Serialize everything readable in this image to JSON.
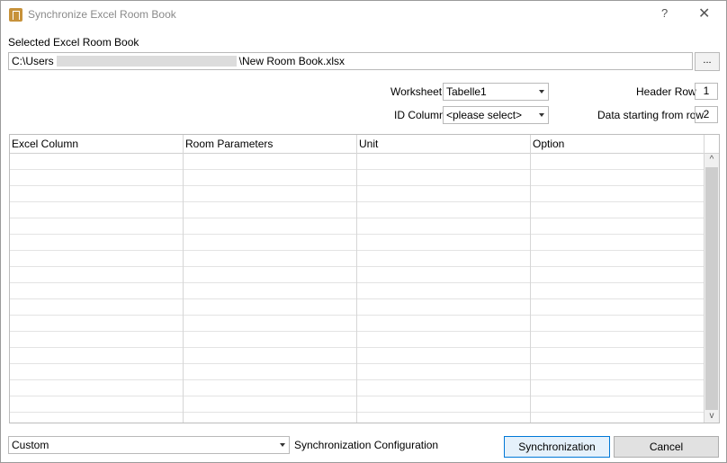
{
  "window": {
    "title": "Synchronize Excel Room Book",
    "help_glyph": "?",
    "close_glyph": "✕"
  },
  "file": {
    "label": "Selected Excel Room Book",
    "path_prefix": "C:\\Users",
    "path_suffix": "\\New Room Book.xlsx",
    "browse_label": "..."
  },
  "settings": {
    "worksheet_label": "Worksheet",
    "worksheet_value": "Tabelle1",
    "id_column_label": "ID Column",
    "id_column_value": "<please select>",
    "header_row_label": "Header Row",
    "header_row_value": "1",
    "data_start_label": "Data starting from row",
    "data_start_value": "2"
  },
  "grid": {
    "columns": [
      "Excel Column",
      "Room Parameters",
      "Unit",
      "Option"
    ],
    "scroll_up": "^",
    "scroll_down": "v"
  },
  "footer": {
    "config_value": "Custom",
    "config_label": "Synchronization Configuration",
    "sync_button": "Synchronization",
    "cancel_button": "Cancel"
  }
}
